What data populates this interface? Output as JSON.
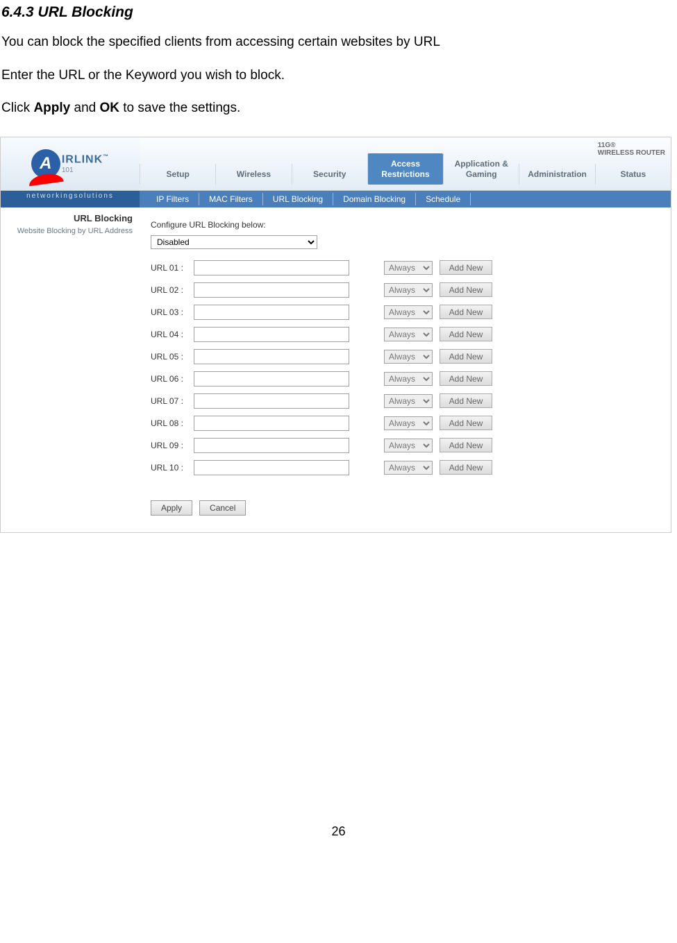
{
  "doc": {
    "heading": "6.4.3 URL Blocking",
    "para1": "You can block the specified clients from accessing certain websites by URL",
    "para2": "Enter the URL or the Keyword you wish to block.",
    "para3_pre": "Click ",
    "para3_b1": "Apply",
    "para3_mid": " and ",
    "para3_b2": "OK",
    "para3_post": " to save the settings.",
    "page_number": "26"
  },
  "router": {
    "brand_tag": "WIRELESS ROUTER",
    "brand_sup": "11G",
    "logo_text": "IRLINK",
    "logo_sup": "™",
    "tagline": "networkingsolutions",
    "tabs": [
      {
        "label": "Setup",
        "name": "tab-setup"
      },
      {
        "label": "Wireless",
        "name": "tab-wireless"
      },
      {
        "label": "Security",
        "name": "tab-security"
      },
      {
        "label": "Access Restrictions",
        "name": "tab-access-restrictions",
        "active": true
      },
      {
        "label": "Application & Gaming",
        "name": "tab-app-gaming"
      },
      {
        "label": "Administration",
        "name": "tab-administration"
      },
      {
        "label": "Status",
        "name": "tab-status"
      }
    ],
    "subnav": [
      {
        "label": "IP Filters",
        "name": "subnav-ip-filters"
      },
      {
        "label": "MAC Filters",
        "name": "subnav-mac-filters"
      },
      {
        "label": "URL Blocking",
        "name": "subnav-url-blocking"
      },
      {
        "label": "Domain Blocking",
        "name": "subnav-domain-blocking"
      },
      {
        "label": "Schedule",
        "name": "subnav-schedule"
      }
    ],
    "panel": {
      "title": "URL Blocking",
      "subtitle": "Website Blocking by URL Address",
      "instruction": "Configure URL Blocking below:",
      "status_value": "Disabled",
      "url_rows": [
        {
          "label": "URL 01 :",
          "sched": "Always",
          "btn": "Add New"
        },
        {
          "label": "URL 02 :",
          "sched": "Always",
          "btn": "Add New"
        },
        {
          "label": "URL 03 :",
          "sched": "Always",
          "btn": "Add New"
        },
        {
          "label": "URL 04 :",
          "sched": "Always",
          "btn": "Add New"
        },
        {
          "label": "URL 05 :",
          "sched": "Always",
          "btn": "Add New"
        },
        {
          "label": "URL 06 :",
          "sched": "Always",
          "btn": "Add New"
        },
        {
          "label": "URL 07 :",
          "sched": "Always",
          "btn": "Add New"
        },
        {
          "label": "URL 08 :",
          "sched": "Always",
          "btn": "Add New"
        },
        {
          "label": "URL 09 :",
          "sched": "Always",
          "btn": "Add New"
        },
        {
          "label": "URL 10 :",
          "sched": "Always",
          "btn": "Add New"
        }
      ],
      "apply_label": "Apply",
      "cancel_label": "Cancel"
    }
  }
}
